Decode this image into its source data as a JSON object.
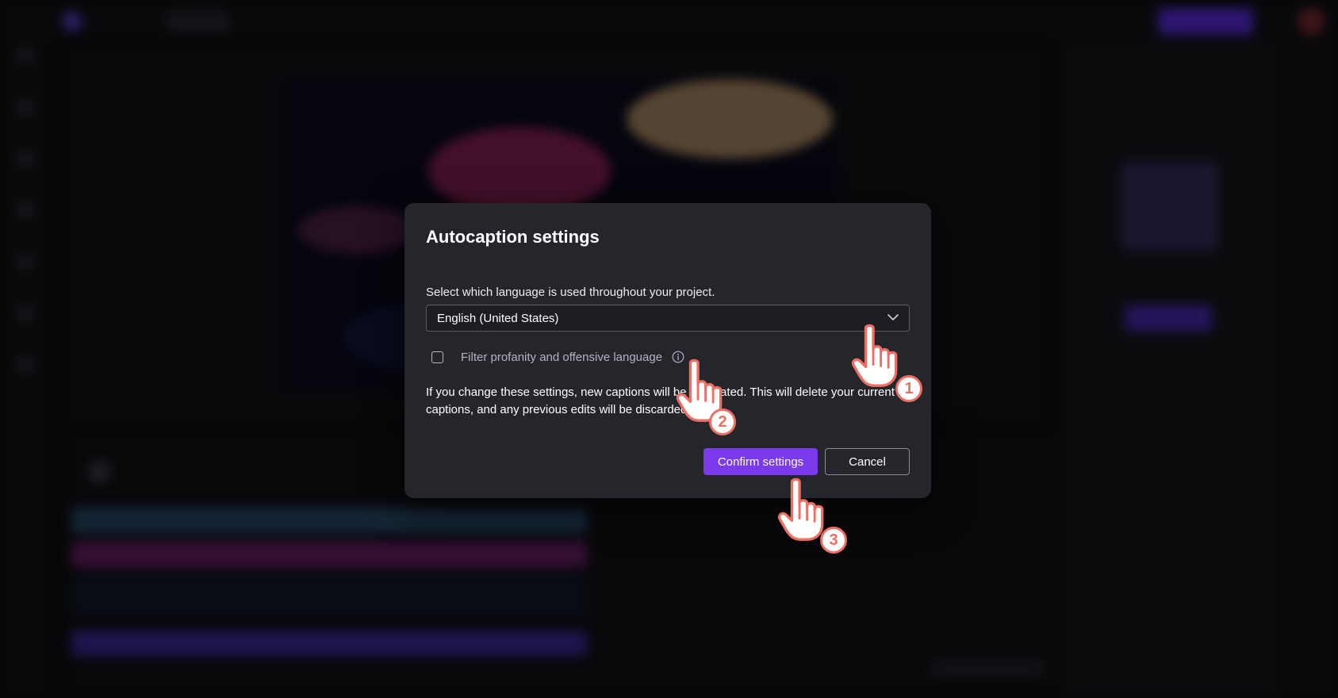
{
  "dialog": {
    "title": "Autocaption settings",
    "language_prompt": "Select which language is used throughout your project.",
    "language_selected": "English (United States)",
    "filter_label": "Filter profanity and offensive language",
    "filter_checked": false,
    "warning_text": "If you change these settings, new captions will be generated. This will delete your current captions, and any previous edits will be discarded.",
    "confirm_label": "Confirm settings",
    "cancel_label": "Cancel"
  },
  "accent_color": "#7c3aed",
  "callout_color": "#ee6f62",
  "callouts": [
    {
      "number": "1",
      "target": "language-dropdown"
    },
    {
      "number": "2",
      "target": "info-icon"
    },
    {
      "number": "3",
      "target": "confirm-settings-button"
    }
  ],
  "icons": [
    "chevron-down-icon",
    "info-icon",
    "pointing-hand-icon"
  ]
}
